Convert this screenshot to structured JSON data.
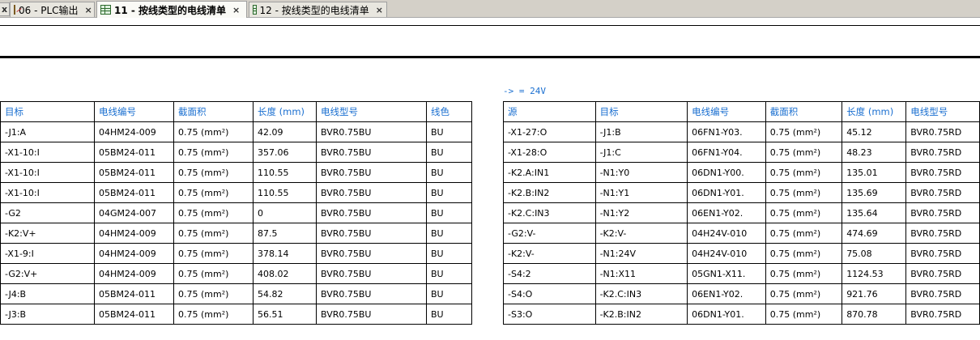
{
  "tabs": [
    {
      "label": "06 - PLC输出",
      "icon": "document-icon",
      "close": "×"
    },
    {
      "label": "11 - 按线类型的电线清单",
      "icon": "table-icon",
      "close": "×",
      "active": true
    },
    {
      "label": "12 - 按线类型的电线清单",
      "icon": "table-icon",
      "close": "×"
    }
  ],
  "lead_close": "x",
  "voltage_label": "-> = 24V",
  "left_table": {
    "headers": [
      "目标",
      "电线编号",
      "截面积",
      "长度 (mm)",
      "电线型号",
      "线色"
    ],
    "rows": [
      [
        "-J1:A",
        "04HM24-009",
        "0.75 (mm²)",
        "42.09",
        "BVR0.75BU",
        "BU"
      ],
      [
        "-X1-10:I",
        "05BM24-011",
        "0.75 (mm²)",
        "357.06",
        "BVR0.75BU",
        "BU"
      ],
      [
        "-X1-10:I",
        "05BM24-011",
        "0.75 (mm²)",
        "110.55",
        "BVR0.75BU",
        "BU"
      ],
      [
        "-X1-10:I",
        "05BM24-011",
        "0.75 (mm²)",
        "110.55",
        "BVR0.75BU",
        "BU"
      ],
      [
        "-G2",
        "04GM24-007",
        "0.75 (mm²)",
        "0",
        "BVR0.75BU",
        "BU"
      ],
      [
        "-K2:V+",
        "04HM24-009",
        "0.75 (mm²)",
        "87.5",
        "BVR0.75BU",
        "BU"
      ],
      [
        "-X1-9:I",
        "04HM24-009",
        "0.75 (mm²)",
        "378.14",
        "BVR0.75BU",
        "BU"
      ],
      [
        "-G2:V+",
        "04HM24-009",
        "0.75 (mm²)",
        "408.02",
        "BVR0.75BU",
        "BU"
      ],
      [
        "-J4:B",
        "05BM24-011",
        "0.75 (mm²)",
        "54.82",
        "BVR0.75BU",
        "BU"
      ],
      [
        "-J3:B",
        "05BM24-011",
        "0.75 (mm²)",
        "56.51",
        "BVR0.75BU",
        "BU"
      ]
    ]
  },
  "right_table": {
    "headers": [
      "源",
      "目标",
      "电线编号",
      "截面积",
      "长度 (mm)",
      "电线型号"
    ],
    "rows": [
      [
        "-X1-27:O",
        "-J1:B",
        "06FN1-Y03.",
        "0.75 (mm²)",
        "45.12",
        "BVR0.75RD"
      ],
      [
        "-X1-28:O",
        "-J1:C",
        "06FN1-Y04.",
        "0.75 (mm²)",
        "48.23",
        "BVR0.75RD"
      ],
      [
        "-K2.A:IN1",
        "-N1:Y0",
        "06DN1-Y00.",
        "0.75 (mm²)",
        "135.01",
        "BVR0.75RD"
      ],
      [
        "-K2.B:IN2",
        "-N1:Y1",
        "06DN1-Y01.",
        "0.75 (mm²)",
        "135.69",
        "BVR0.75RD"
      ],
      [
        "-K2.C:IN3",
        "-N1:Y2",
        "06EN1-Y02.",
        "0.75 (mm²)",
        "135.64",
        "BVR0.75RD"
      ],
      [
        "-G2:V-",
        "-K2:V-",
        "04H24V-010",
        "0.75 (mm²)",
        "474.69",
        "BVR0.75RD"
      ],
      [
        "-K2:V-",
        "-N1:24V",
        "04H24V-010",
        "0.75 (mm²)",
        "75.08",
        "BVR0.75RD"
      ],
      [
        "-S4:2",
        "-N1:X11",
        "05GN1-X11.",
        "0.75 (mm²)",
        "1124.53",
        "BVR0.75RD"
      ],
      [
        "-S4:O",
        "-K2.C:IN3",
        "06EN1-Y02.",
        "0.75 (mm²)",
        "921.76",
        "BVR0.75RD"
      ],
      [
        "-S3:O",
        "-K2.B:IN2",
        "06DN1-Y01.",
        "0.75 (mm²)",
        "870.78",
        "BVR0.75RD"
      ]
    ]
  }
}
